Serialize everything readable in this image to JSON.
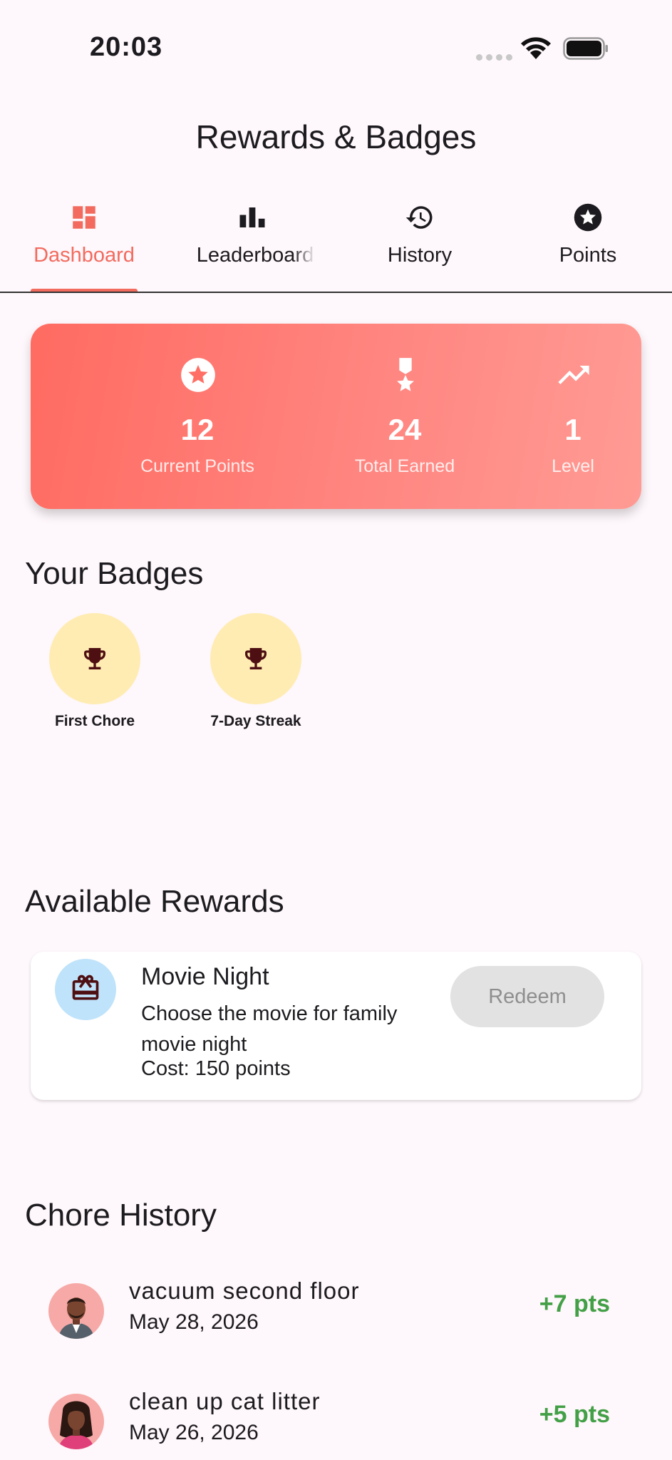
{
  "status_bar": {
    "time": "20:03",
    "icons": [
      "cellular-dots-icon",
      "wifi-icon",
      "battery-icon"
    ]
  },
  "app_bar": {
    "title": "Rewards & Badges"
  },
  "tabs": [
    {
      "label": "Dashboard",
      "icon": "dashboard-icon",
      "active": true
    },
    {
      "label": "Leaderboard",
      "icon": "bar-chart-icon",
      "active": false
    },
    {
      "label": "History",
      "icon": "history-icon",
      "active": false
    },
    {
      "label": "Points",
      "icon": "star-circle-icon",
      "active": false
    }
  ],
  "stats": [
    {
      "value": "12",
      "label": "Current Points",
      "icon": "star-circle-icon"
    },
    {
      "value": "24",
      "label": "Total Earned",
      "icon": "military-medal-icon"
    },
    {
      "value": "1",
      "label": "Level",
      "icon": "trending-up-icon"
    }
  ],
  "badges_section": {
    "title": "Your Badges",
    "badges": [
      {
        "label": "First Chore",
        "icon": "trophy-icon"
      },
      {
        "label": "7-Day Streak",
        "icon": "trophy-icon"
      }
    ]
  },
  "rewards_section": {
    "title": "Available Rewards",
    "rewards": [
      {
        "title": "Movie Night",
        "description": "Choose the movie for family movie night",
        "cost": "Cost: 150 points",
        "button": "Redeem",
        "icon": "gift-card-icon"
      }
    ]
  },
  "history_section": {
    "title": "Chore History",
    "items": [
      {
        "title": "vacuum second floor",
        "date": "May 28, 2026",
        "points": "+7 pts",
        "avatar": "man-avatar"
      },
      {
        "title": "clean up cat litter",
        "date": "May 26, 2026",
        "points": "+5 pts",
        "avatar": "woman-avatar"
      }
    ]
  },
  "colors": {
    "accent": "#F26B5E",
    "background": "#FEF7FB",
    "points_green": "#43A047",
    "badge_bg": "#FFECB3",
    "reward_icon_bg": "#BFE3FA"
  }
}
